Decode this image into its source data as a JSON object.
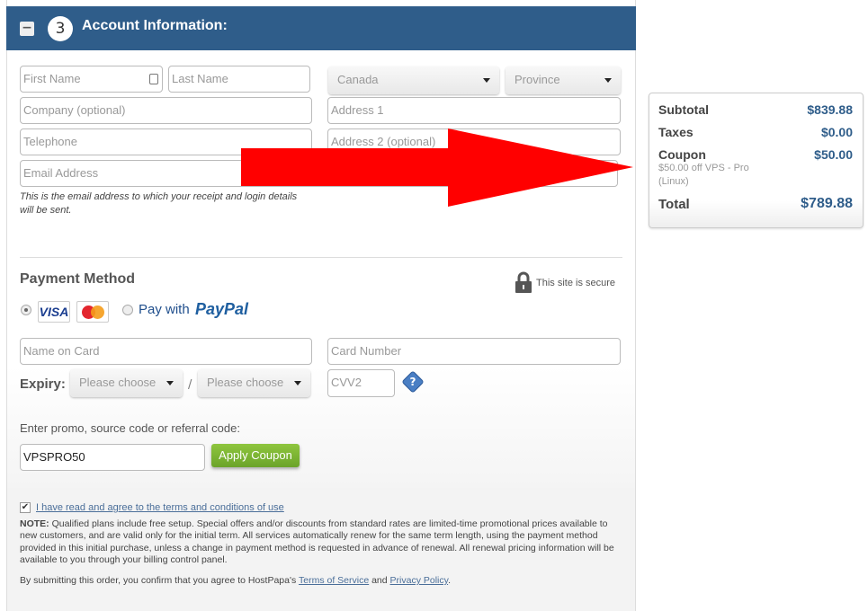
{
  "header": {
    "step": "3",
    "title": "Account Information:",
    "collapse_icon": "minus-icon",
    "color": "#2f5d8a"
  },
  "account": {
    "first_name_placeholder": "First Name",
    "last_name_placeholder": "Last Name",
    "country": "Canada",
    "province": "Province",
    "company_placeholder": "Company (optional)",
    "address1_placeholder": "Address 1",
    "telephone_placeholder": "Telephone",
    "address2_placeholder": "Address 2 (optional)",
    "email_placeholder": "Email Address",
    "email_note": "This is the email address to which your receipt and login details will be sent."
  },
  "payment": {
    "title": "Payment Method",
    "secure": "This site is secure",
    "visa": "VISA",
    "pay_with": "Pay with",
    "paypal": "PayPal",
    "selected_method": "card",
    "name_on_card_placeholder": "Name on Card",
    "card_number_placeholder": "Card Number",
    "expiry_label": "Expiry:",
    "expiry_month": "Please choose",
    "expiry_separator": "/",
    "expiry_year": "Please choose",
    "cvv_placeholder": "CVV2",
    "help_icon": "?",
    "promo_label": "Enter promo, source code or referral code:",
    "promo_value": "VPSPRO50",
    "apply_label": "Apply Coupon"
  },
  "footer": {
    "terms_checked": true,
    "terms_label": "I have read and agree to the terms and conditions of use",
    "note_label": "NOTE:",
    "note_text": " Qualified plans include free setup. Special offers and/or discounts from standard rates are limited-time promotional prices available to new customers, and are valid only for the initial term. All services automatically renew for the same term length, using the payment method provided in this initial purchase, unless a change in payment method is requested in advance of renewal. All renewal pricing information will be available to you through your billing control panel.",
    "submit_prefix": "By submitting this order, you confirm that you agree to HostPapa's ",
    "tos": "Terms of Service",
    "and": " and ",
    "privacy": "Privacy Policy",
    "end": "."
  },
  "summary": {
    "subtotal_label": "Subtotal",
    "subtotal": "$839.88",
    "taxes_label": "Taxes",
    "taxes": "$0.00",
    "coupon_label": "Coupon",
    "coupon": "$50.00",
    "coupon_desc": "$50.00 off VPS - Pro (Linux)",
    "total_label": "Total",
    "total": "$789.88"
  },
  "annotation": {
    "arrow_color": "#ff0000"
  }
}
